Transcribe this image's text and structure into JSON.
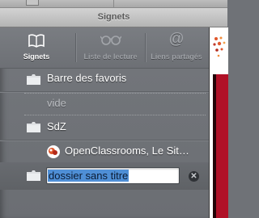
{
  "window": {
    "title": "Signets"
  },
  "tabs": [
    {
      "label": "Signets",
      "icon": "book-icon",
      "active": true
    },
    {
      "label": "Liste de lecture",
      "icon": "glasses-icon",
      "active": false
    },
    {
      "label": "Liens partagés",
      "icon": "at-icon",
      "active": false
    }
  ],
  "bookmarks": {
    "items": [
      {
        "label": "Barre des favoris",
        "icon": "folder-icon"
      },
      {
        "label": "vide",
        "icon": ""
      },
      {
        "label": "SdZ",
        "icon": "folder-icon"
      },
      {
        "label": "OpenClassrooms, Le Sit…",
        "icon": "site-favicon"
      }
    ],
    "new_folder": {
      "value": "dossier sans titre",
      "icon": "folder-icon"
    }
  },
  "colors": {
    "selection": "#4f8fd6",
    "sidebar": "#6f7277",
    "accent_red": "#b01127"
  }
}
